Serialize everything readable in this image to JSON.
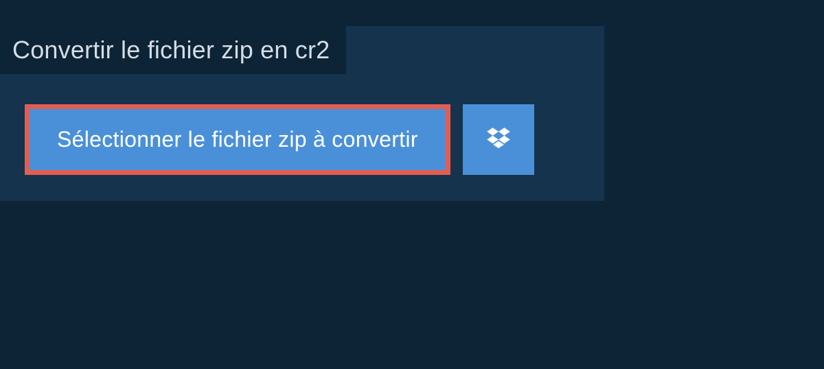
{
  "title": "Convertir le fichier zip en cr2",
  "selectButton": {
    "label": "Sélectionner le fichier zip à convertir"
  },
  "colors": {
    "background": "#0d2437",
    "panel": "#15334d",
    "buttonBg": "#4a90d9",
    "highlightBorder": "#e35d52",
    "titleText": "#d5dde4",
    "buttonText": "#ffffff"
  }
}
